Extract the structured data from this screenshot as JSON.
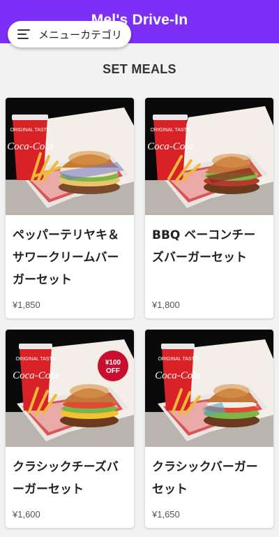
{
  "app": {
    "title": "Mel's Drive-In"
  },
  "category_button": {
    "label": "メニューカテゴリ"
  },
  "section": {
    "title": "SET MEALS"
  },
  "products": [
    {
      "name": "ペッパーテリヤキ＆サワークリームバーガーセット",
      "price": "¥1,850",
      "cup_text": "Coca-Cola",
      "badge": ""
    },
    {
      "name": "BBQ ベーコンチーズバーガーセット",
      "price": "¥1,800",
      "cup_text": "Coca-Cola",
      "badge": ""
    },
    {
      "name": "クラシックチーズバーガーセット",
      "price": "¥1,600",
      "cup_text": "Coca-Cola",
      "badge": "¥100 OFF",
      "badge_line1": "¥100",
      "badge_line2": "OFF"
    },
    {
      "name": "クラシックバーガーセット",
      "price": "¥1,650",
      "cup_text": "Coca-Cola",
      "badge": ""
    }
  ],
  "colors": {
    "appbar": "#7c2ff6",
    "badge": "#c8102e",
    "cup": "#d92228"
  }
}
